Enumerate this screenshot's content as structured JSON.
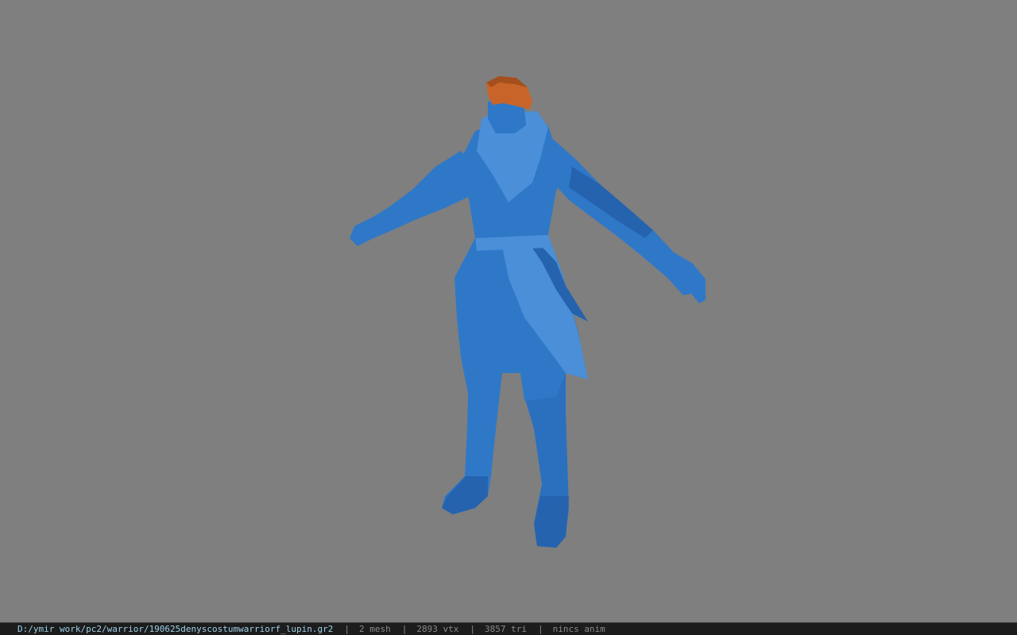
{
  "window": {
    "background_color": "#7f7f7f"
  },
  "viewport": {
    "model": {
      "body_color": "#2f78c8",
      "body_shade_color": "#2563ae",
      "body_light_color": "#4a8fd8",
      "head_color": "#c8642a",
      "head_shade_color": "#a44f1e"
    }
  },
  "statusbar": {
    "file_path": "D:/ymir work/pc2/warrior/190625denyscostumwarriorf_lupin.gr2",
    "separator": "|",
    "mesh_count": "2 mesh",
    "vertex_count": "2893 vtx",
    "triangle_count": "3857 tri",
    "anim_status": "nincs anim",
    "path_color": "#9ed0e8",
    "text_color": "#8a8a8a"
  }
}
